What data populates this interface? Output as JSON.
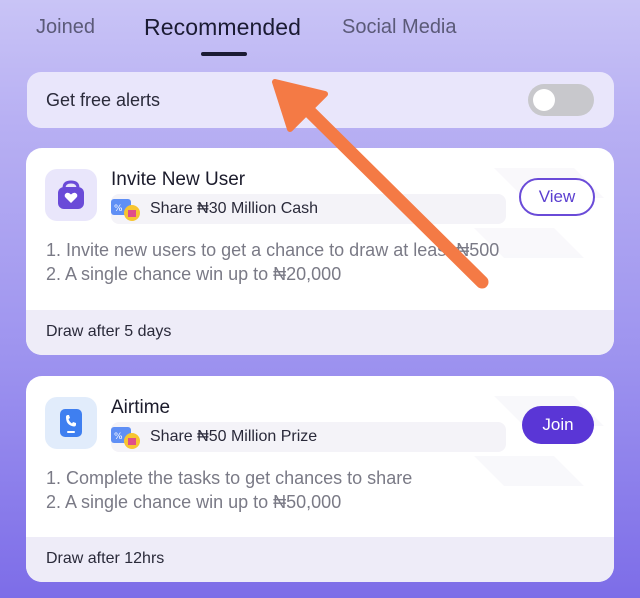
{
  "tabs": {
    "joined": "Joined",
    "recommended": "Recommended",
    "social_media": "Social Media",
    "active": "Recommended"
  },
  "alerts": {
    "label": "Get free alerts",
    "enabled": false
  },
  "cards": [
    {
      "title": "Invite New User",
      "icon": "heart-bag-icon",
      "reward": "Share ₦30 Million Cash",
      "button": "View",
      "lines": [
        "1. Invite new users to get a chance to draw at least ₦500",
        "2. A single chance win up to ₦20,000"
      ],
      "footer": "Draw after 5 days"
    },
    {
      "title": "Airtime",
      "icon": "phone-icon",
      "reward": "Share ₦50 Million Prize",
      "button": "Join",
      "lines": [
        "1. Complete the tasks to get chances to share",
        "2. A single chance win up to ₦50,000"
      ],
      "footer": "Draw after 12hrs"
    }
  ],
  "colors": {
    "accent": "#5a36d6",
    "annotation_arrow": "#f47a45"
  }
}
